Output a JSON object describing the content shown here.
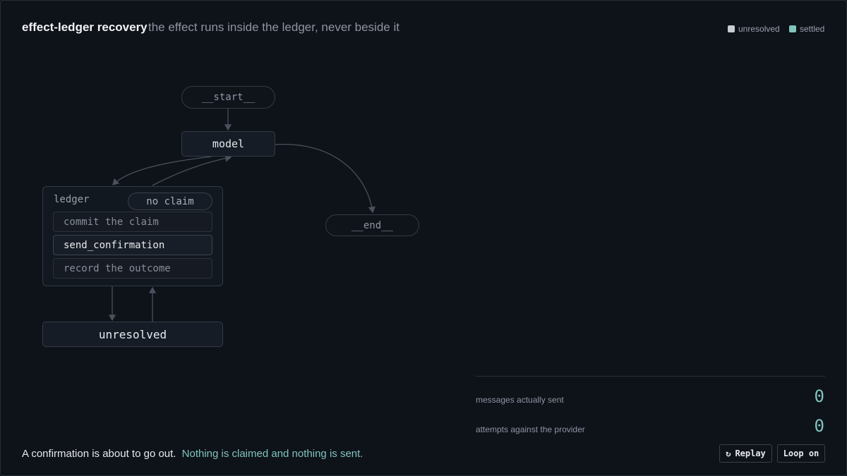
{
  "header": {
    "title": "effect-ledger recovery",
    "subtitle": "the effect runs inside the ledger, never beside it"
  },
  "legend": {
    "items": [
      {
        "label": "unresolved",
        "color": "#c9ccd1"
      },
      {
        "label": "settled",
        "color": "#7fc4bd"
      }
    ]
  },
  "graph": {
    "start_label": "__start__",
    "model_label": "model",
    "end_label": "__end__",
    "ledger": {
      "label": "ledger",
      "claim_status": "no claim",
      "steps": [
        "commit the claim",
        "send_confirmation",
        "record the outcome"
      ]
    },
    "unresolved_label": "unresolved"
  },
  "stats": [
    {
      "label": "messages actually sent",
      "value": "0"
    },
    {
      "label": "attempts against the provider",
      "value": "0"
    }
  ],
  "caption": {
    "main": "A confirmation is about to go out.",
    "accent": "Nothing is claimed and nothing is sent."
  },
  "controls": {
    "replay_icon": "↻",
    "replay_label": "Replay",
    "loop_label": "Loop on"
  },
  "colors": {
    "accent": "#7fc4bd",
    "background": "#0e1219"
  }
}
